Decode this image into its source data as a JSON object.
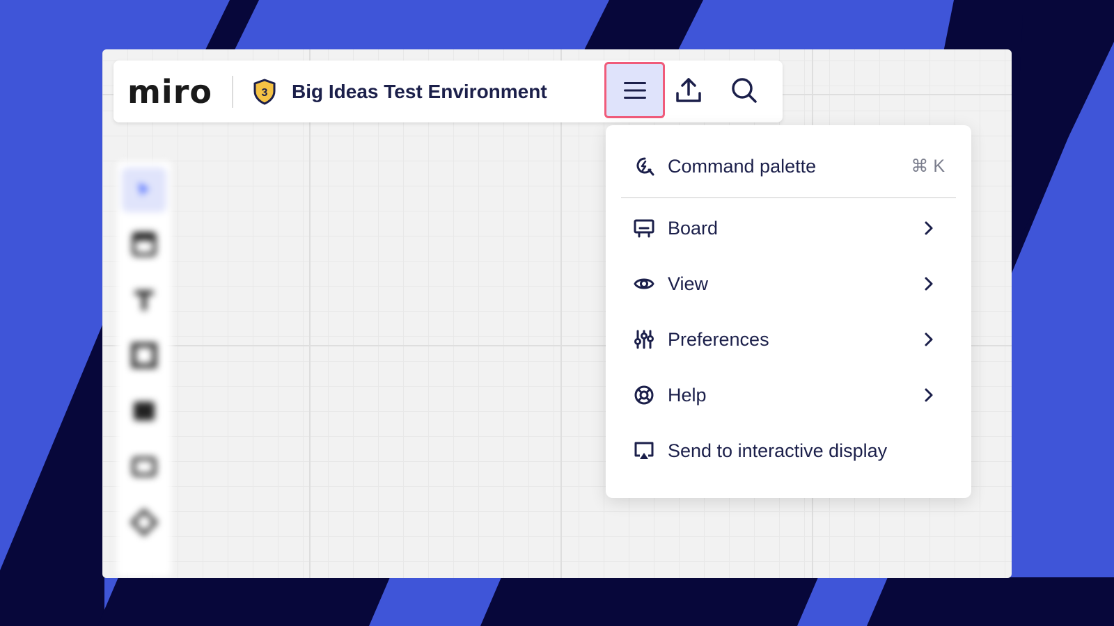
{
  "app": {
    "logo": "miro",
    "board_title": "Big Ideas Test Environment",
    "badge_number": "3"
  },
  "topbar": {
    "menu_icon": "hamburger-menu-icon",
    "share_icon": "upload-icon",
    "search_icon": "search-icon"
  },
  "menu": {
    "items": [
      {
        "label": "Command palette",
        "icon": "command-palette-icon",
        "shortcut": "⌘ K"
      },
      {
        "label": "Board",
        "icon": "board-icon",
        "has_submenu": true
      },
      {
        "label": "View",
        "icon": "eye-icon",
        "has_submenu": true
      },
      {
        "label": "Preferences",
        "icon": "sliders-icon",
        "has_submenu": true
      },
      {
        "label": "Help",
        "icon": "lifebuoy-icon",
        "has_submenu": true
      },
      {
        "label": "Send to interactive display",
        "icon": "cast-display-icon"
      }
    ]
  },
  "colors": {
    "background": "#3f55d8",
    "stripe": "#0a0a3a",
    "accent": "#4262ff",
    "highlight_border": "#f05b7a",
    "text": "#1b1f4a"
  }
}
